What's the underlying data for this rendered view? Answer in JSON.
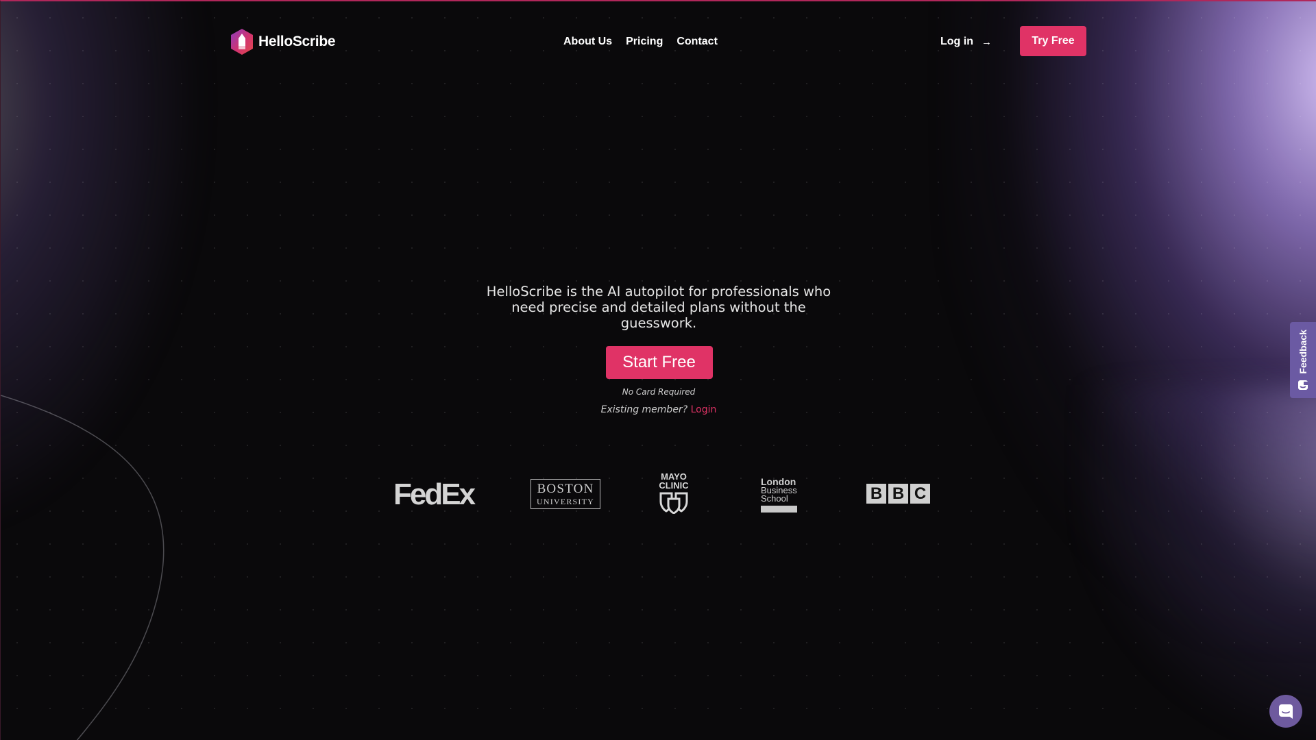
{
  "brand": {
    "name": "HelloScribe",
    "logo_icon": "hexagon-pen-icon"
  },
  "nav": {
    "items": [
      {
        "label": "About Us"
      },
      {
        "label": "Pricing"
      },
      {
        "label": "Contact"
      }
    ],
    "login_label": "Log in",
    "login_icon": "arrow-right-icon",
    "try_free_label": "Try Free"
  },
  "hero": {
    "description": "HelloScribe is the AI autopilot for professionals who need precise and detailed plans without the guesswork.",
    "cta_label": "Start Free",
    "no_card_text": "No Card Required",
    "existing_member_text": "Existing member?",
    "login_link_label": "Login"
  },
  "logos": {
    "fedex": "FedEx",
    "boston_line1": "BOSTON",
    "boston_line2": "UNIVERSITY",
    "mayo_line1": "MAYO",
    "mayo_line2": "CLINIC",
    "lbs_line1": "London",
    "lbs_line2": "Business",
    "lbs_line3": "School",
    "bbc_letters": [
      "B",
      "B",
      "C"
    ]
  },
  "feedback": {
    "label": "Feedback",
    "icon": "feedback-icon"
  },
  "chat": {
    "icon": "chat-bubble-icon"
  },
  "colors": {
    "accent": "#e03366",
    "background": "#0a090b",
    "feedback_tab": "#6b5aa3",
    "glow": "#c8b4f5"
  }
}
